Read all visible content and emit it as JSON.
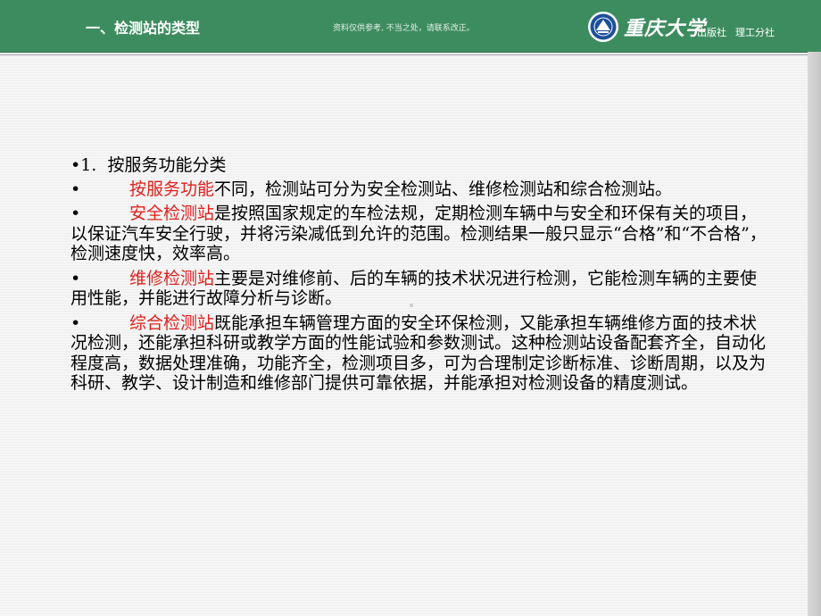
{
  "header": {
    "title": "一、检测站的类型",
    "note": "资料仅供参考, 不当之处，请联系改正。",
    "logo_text": "重庆大学",
    "publisher_1": "出版社",
    "publisher_2": "理工分社"
  },
  "content": {
    "heading_bullet": "•1.",
    "heading_text": "按服务功能分类",
    "bullet": "•",
    "paragraphs": [
      {
        "highlight": "按服务功能",
        "text": "不同，检测站可分为安全检测站、维修检测站和综合检测站。"
      },
      {
        "highlight": "安全检测站",
        "text": "是按照国家规定的车检法规，定期检测车辆中与安全和环保有关的项目，以保证汽车安全行驶，并将污染减低到允许的范围。检测结果一般只显示“合格”和“不合格”，检测速度快，效率高。"
      },
      {
        "highlight": "维修检测站",
        "text": "主要是对维修前、后的车辆的技术状况进行检测，它能检测车辆的主要使用性能，并能进行故障分析与诊断。"
      },
      {
        "highlight": "综合检测站",
        "text": "既能承担车辆管理方面的安全环保检测，又能承担车辆维修方面的技术状况检测，还能承担科研或教学方面的性能试验和参数测试。这种检测站设备配套齐全，自动化程度高，数据处理准确，功能齐全，检测项目多，可为合理制定诊断标准、诊断周期，以及为科研、教学、设计制造和维修部门提供可靠依据，并能承担对检测设备的精度测试。"
      }
    ]
  },
  "colors": {
    "header_bg": "#3d8c5f",
    "highlight": "#e0201b",
    "text": "#000000"
  },
  "icons": {
    "logo": "university-seal-icon"
  }
}
